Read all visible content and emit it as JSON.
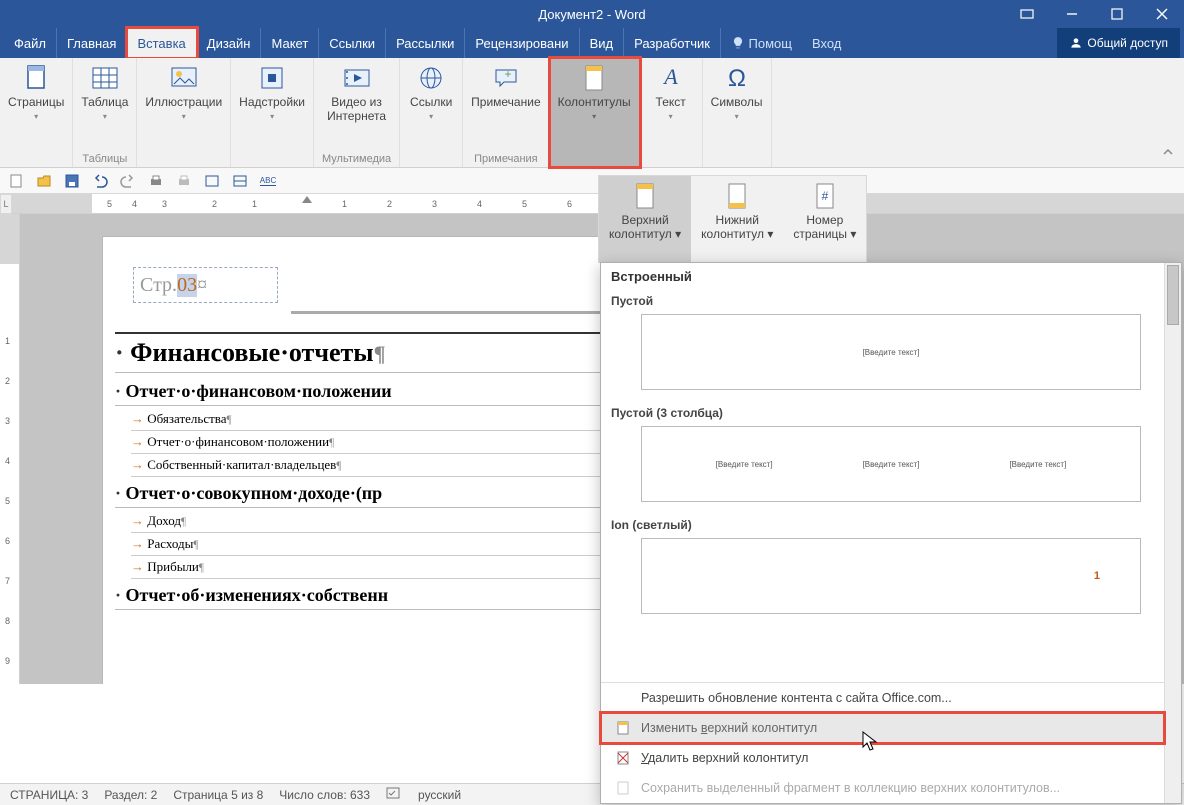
{
  "title": "Документ2 - Word",
  "tabs": {
    "file": "Файл",
    "home": "Главная",
    "insert": "Вставка",
    "design": "Дизайн",
    "layout": "Макет",
    "references": "Ссылки",
    "mailings": "Рассылки",
    "review": "Рецензировани",
    "view": "Вид",
    "developer": "Разработчик",
    "tell": "Помощ",
    "signin": "Вход",
    "share": "Общий доступ"
  },
  "ribbon": {
    "pages": "Страницы",
    "table": "Таблица",
    "tables_grp": "Таблицы",
    "illustrations": "Иллюстрации",
    "addins": "Надстройки",
    "onlinevideo1": "Видео из",
    "onlinevideo2": "Интернета",
    "media_grp": "Мультимедиа",
    "links": "Ссылки",
    "comment": "Примечание",
    "comments_grp": "Примечания",
    "headerfooter": "Колонтитулы",
    "text": "Текст",
    "symbols": "Символы"
  },
  "hf": {
    "header1": "Верхний",
    "header2": "колонтитул",
    "footer1": "Нижний",
    "footer2": "колонтитул",
    "pgnum1": "Номер",
    "pgnum2": "страницы"
  },
  "ruler_corner": "L",
  "header_text_prefix": "Стр.",
  "header_text_sel": "03",
  "header_text_after": "¤",
  "doc": {
    "h1": "Финансовые·отчеты",
    "h2a": "Отчет·о·финансовом·положении",
    "a1": "Обязательства",
    "a2": "Отчет·о·финансовом·положении",
    "a3": "Собственный·капитал·владельцев",
    "h2b": "Отчет·о·совокупном·доходе·(пр",
    "b1": "Доход",
    "b2": "Расходы",
    "b3": "Прибыли",
    "h2c": "Отчет·об·изменениях·собственн"
  },
  "gallery": {
    "builtin": "Встроенный",
    "blank": "Пустой",
    "blank3": "Пустой (3 столбца)",
    "ion": "Ion (светлый)",
    "placeholder": "[Введите текст]",
    "ion_pg": "1",
    "more": "Разрешить обновление контента с сайта Office.com...",
    "edit_pre": "Изменить ",
    "edit_u": "в",
    "edit_post": "ерхний колонтитул",
    "remove_pre": "",
    "remove_u": "У",
    "remove_post": "далить верхний колонтитул",
    "save": "Сохранить выделенный фрагмент в коллекцию верхних колонтитулов..."
  },
  "status": {
    "page": "СТРАНИЦА: 3",
    "section": "Раздел: 2",
    "pageof": "Страница 5 из 8",
    "words": "Число слов: 633",
    "lang": "русский"
  },
  "qat_spellcheck": "ABC"
}
